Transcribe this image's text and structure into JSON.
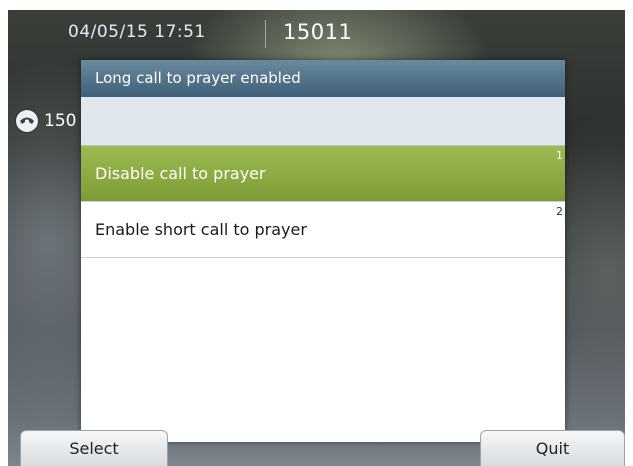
{
  "status_bar": {
    "datetime": "04/05/15 17:51",
    "extension": "15011"
  },
  "line": {
    "icon": "handset-icon",
    "label": "150"
  },
  "dialog": {
    "title": "Long call to prayer enabled",
    "items": [
      {
        "label": "Disable call to prayer",
        "number": "1",
        "selected": true
      },
      {
        "label": "Enable short call to prayer",
        "number": "2",
        "selected": false
      }
    ]
  },
  "softkeys": {
    "left": "Select",
    "right": "Quit"
  },
  "colors": {
    "title_bar": "#3f5f76",
    "selected_item": "#8aa843",
    "input_area": "#dfe6ec"
  }
}
